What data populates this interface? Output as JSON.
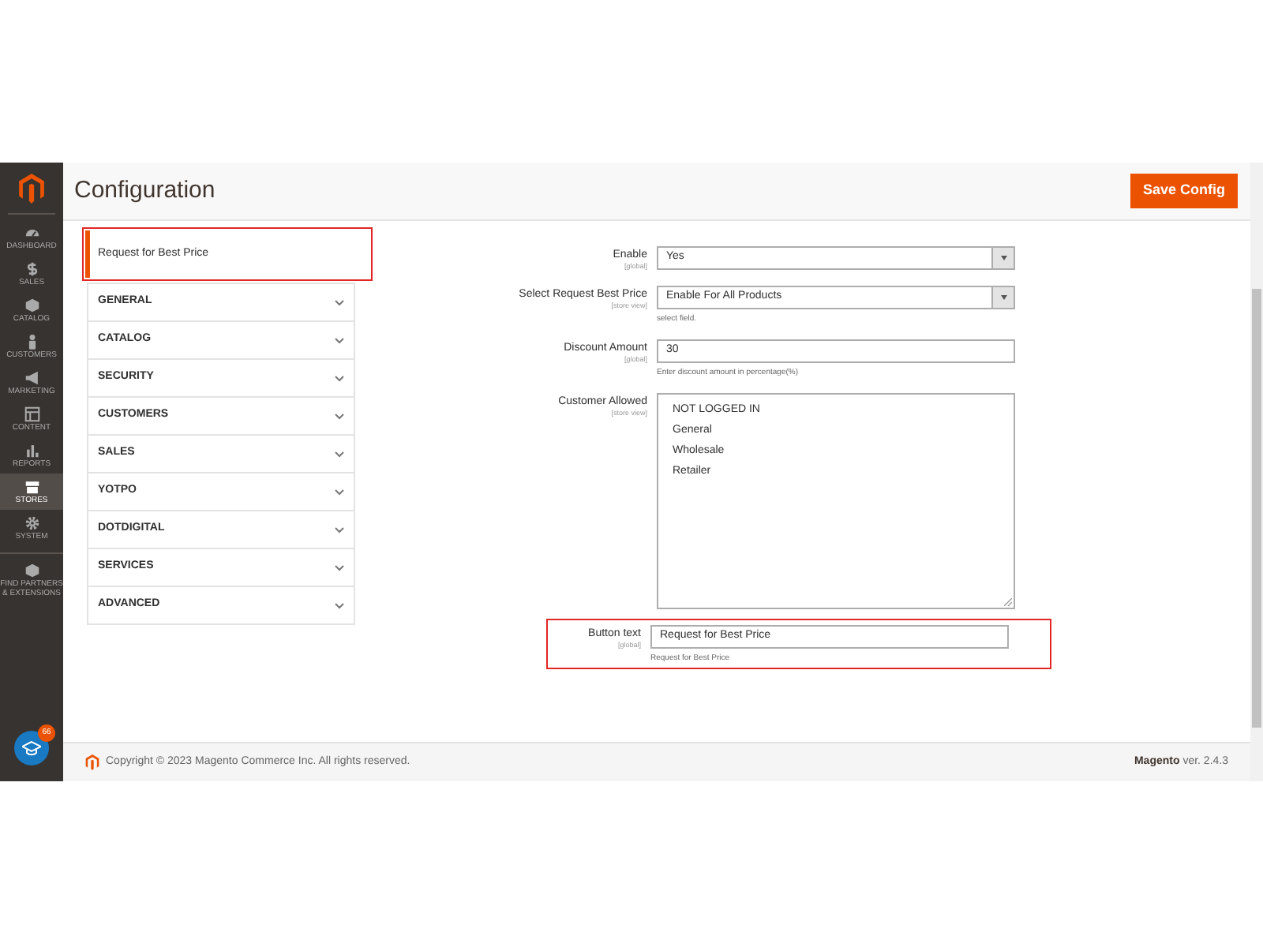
{
  "sidebar": {
    "items": [
      {
        "label": "DASHBOARD",
        "selected": false
      },
      {
        "label": "SALES",
        "selected": false
      },
      {
        "label": "CATALOG",
        "selected": false
      },
      {
        "label": "CUSTOMERS",
        "selected": false
      },
      {
        "label": "MARKETING",
        "selected": false
      },
      {
        "label": "CONTENT",
        "selected": false
      },
      {
        "label": "REPORTS",
        "selected": false
      },
      {
        "label": "STORES",
        "selected": true
      },
      {
        "label": "SYSTEM",
        "selected": false
      },
      {
        "label": "FIND PARTNERS & EXTENSIONS",
        "selected": false
      }
    ],
    "notification_count": "66"
  },
  "header": {
    "title": "Configuration",
    "save_button": "Save Config"
  },
  "config_nav": {
    "active_item": {
      "label": "Request for Best Price",
      "highlighted": true
    },
    "sections": [
      "GENERAL",
      "CATALOG",
      "SECURITY",
      "CUSTOMERS",
      "SALES",
      "YOTPO",
      "DOTDIGITAL",
      "SERVICES",
      "ADVANCED"
    ]
  },
  "fields": [
    {
      "kind": "select",
      "label": "Enable",
      "scope": "[global]",
      "value": "Yes",
      "highlighted": false
    },
    {
      "kind": "select",
      "label": "Select Request Best Price",
      "scope": "[store view]",
      "value": "Enable For All Products",
      "note": "select field.",
      "highlighted": false
    },
    {
      "kind": "text",
      "label": "Discount Amount",
      "scope": "[global]",
      "value": "30",
      "note": "Enter discount amount in percentage(%)",
      "highlighted": false
    },
    {
      "kind": "multiselect",
      "label": "Customer Allowed",
      "scope": "[store view]",
      "options": [
        "NOT LOGGED IN",
        "General",
        "Wholesale",
        "Retailer"
      ],
      "highlighted": false
    },
    {
      "kind": "text",
      "label": "Button text",
      "scope": "[global]",
      "value": "Request for Best Price",
      "note": "Request for Best Price",
      "highlighted": true
    }
  ],
  "footer": {
    "copyright": "Copyright © 2023 Magento Commerce Inc. All rights reserved.",
    "brand": "Magento",
    "version": "ver. 2.4.3"
  }
}
